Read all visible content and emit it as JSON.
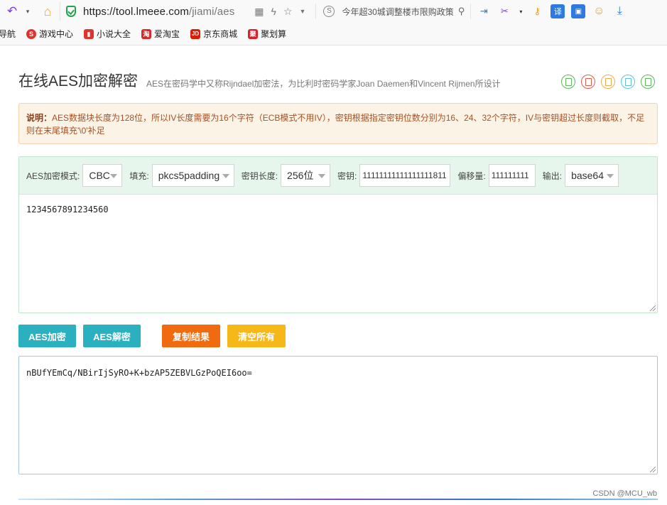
{
  "browser": {
    "url_host": "https://tool.lmeee.com",
    "url_path": "/jiami/aes",
    "news_text": "今年超30城调整楼市限购政策",
    "bookmarks": [
      {
        "label": "导航",
        "icon": "none",
        "color": "#f9f9f9"
      },
      {
        "label": "游戏中心",
        "icon": "game-icon",
        "color": "#e0332e"
      },
      {
        "label": "小说大全",
        "icon": "book-icon",
        "color": "#e0332e"
      },
      {
        "label": "爱淘宝",
        "icon": "taobao-icon",
        "color": "#d62a2a"
      },
      {
        "label": "京东商城",
        "icon": "jd-icon",
        "color": "#d81e06"
      },
      {
        "label": "聚划算",
        "icon": "juhuasuan-icon",
        "color": "#d91f2a"
      }
    ]
  },
  "page": {
    "title": "在线AES加密解密",
    "subtitle": "AES在密码学中又称Rijndael加密法，为比利时密码学家Joan Daemen和Vincent Rijmen所设计",
    "share_icon_colors": [
      "#5cb85c",
      "#e25b4f",
      "#f0ad4e",
      "#5bc0de",
      "#5cb85c"
    ],
    "note_label": "说明：",
    "note_text": "AES数据块长度为128位，所以IV长度需要为16个字符（ECB模式不用IV），密钥根据指定密钥位数分别为16、24、32个字符，IV与密钥超过长度则截取，不足则在末尾填充'\\0'补足"
  },
  "options": {
    "mode_label": "AES加密模式:",
    "mode_value": "CBC",
    "padding_label": "填充:",
    "padding_value": "pkcs5padding",
    "keylen_label": "密钥长度:",
    "keylen_value": "256位",
    "key_label": "密钥:",
    "key_value": "11111111111111111811",
    "iv_label": "偏移量:",
    "iv_value": "111111111",
    "output_label": "输出:",
    "output_value": "base64"
  },
  "input_text": "1234567891234560",
  "buttons": {
    "encrypt": "AES加密",
    "decrypt": "AES解密",
    "copy": "复制结果",
    "clear": "清空所有"
  },
  "button_colors": {
    "encrypt": "#2ab0bf",
    "decrypt": "#2ab0bf",
    "copy": "#f06a0f",
    "clear": "#f5b818"
  },
  "result_text": "nBUfYEmCq/NBirIjSyRO+K+bzAP5ZEBVLGzPoQEI6oo=",
  "watermark": "CSDN @MCU_wb"
}
